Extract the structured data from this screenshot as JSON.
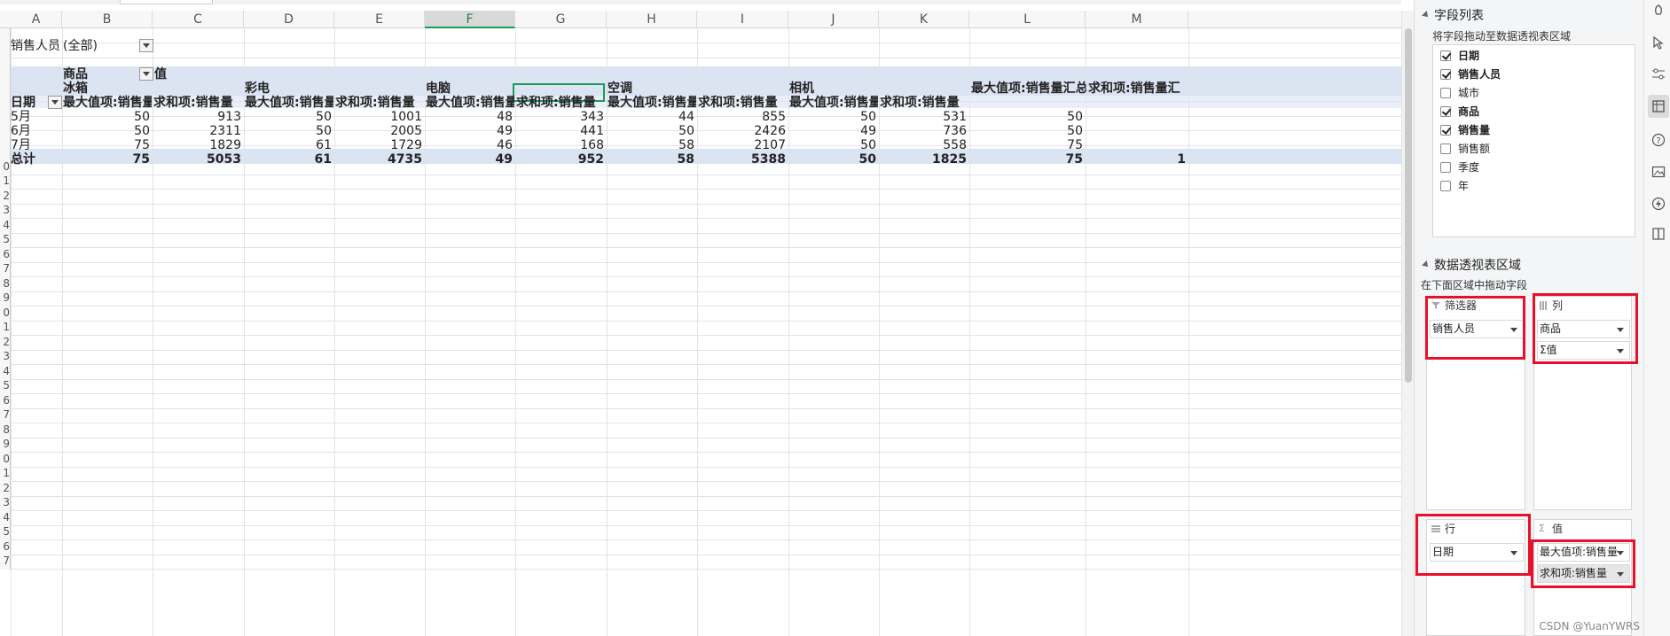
{
  "sheet": {
    "columns": [
      "A",
      "B",
      "C",
      "D",
      "E",
      "F",
      "G",
      "H",
      "I",
      "J",
      "K",
      "L",
      "M"
    ],
    "selected_column": "F",
    "row_numbers": [
      "",
      "",
      "",
      "",
      "",
      "",
      "",
      "",
      "",
      "0",
      "1",
      "2",
      "3",
      "4",
      "5",
      "6",
      "7",
      "8",
      "9",
      "0",
      "1",
      "2",
      "3",
      "4",
      "5",
      "6",
      "7",
      "8",
      "9",
      "0",
      "1",
      "2",
      "3",
      "4",
      "5",
      "6",
      "7"
    ],
    "filter": {
      "label": "销售人员",
      "value": "(全部)"
    },
    "pivot": {
      "col_field_label": "商品",
      "values_label": "值",
      "row_field_label": "日期",
      "products": [
        "冰箱",
        "彩电",
        "电脑",
        "空调",
        "相机"
      ],
      "grand_max_label": "最大值项:销售量汇总",
      "grand_sum_label": "求和项:销售量汇",
      "measure_headers": [
        "最大值项:销售量",
        "求和项:销售量",
        "最大值项:销售量",
        "求和项:销售量",
        "最大值项:销售量",
        "求和项:销售量",
        "最大值项:销售量",
        "求和项:销售量",
        "最大值项:销售量",
        "求和项:销售量"
      ],
      "rows": [
        {
          "label": "5月",
          "values": [
            "50",
            "913",
            "50",
            "1001",
            "48",
            "343",
            "44",
            "855",
            "50",
            "531",
            "50",
            ""
          ]
        },
        {
          "label": "6月",
          "values": [
            "50",
            "2311",
            "50",
            "2005",
            "49",
            "441",
            "50",
            "2426",
            "49",
            "736",
            "50",
            ""
          ]
        },
        {
          "label": "7月",
          "values": [
            "75",
            "1829",
            "61",
            "1729",
            "46",
            "168",
            "58",
            "2107",
            "50",
            "558",
            "75",
            ""
          ]
        }
      ],
      "total": {
        "label": "总计",
        "values": [
          "75",
          "5053",
          "61",
          "4735",
          "49",
          "952",
          "58",
          "5388",
          "50",
          "1825",
          "75",
          "1"
        ]
      }
    }
  },
  "pane": {
    "field_list_title": "字段列表",
    "field_list_hint": "将字段拖动至数据透视表区域",
    "fields": [
      {
        "label": "日期",
        "checked": true
      },
      {
        "label": "销售人员",
        "checked": true
      },
      {
        "label": "城市",
        "checked": false
      },
      {
        "label": "商品",
        "checked": true
      },
      {
        "label": "销售量",
        "checked": true
      },
      {
        "label": "销售额",
        "checked": false
      },
      {
        "label": "季度",
        "checked": false
      },
      {
        "label": "年",
        "checked": false
      }
    ],
    "areas_title": "数据透视表区域",
    "areas_hint": "在下面区域中拖动字段",
    "filter_area": {
      "title": "筛选器",
      "items": [
        "销售人员"
      ]
    },
    "columns_area": {
      "title": "列",
      "items": [
        "商品",
        "Σ值"
      ]
    },
    "rows_area": {
      "title": "行",
      "items": [
        "日期"
      ]
    },
    "values_area": {
      "title": "值",
      "items": [
        "最大值项:销售量",
        "求和项:销售量"
      ]
    },
    "watermark": "CSDN @YuanYWRS"
  }
}
